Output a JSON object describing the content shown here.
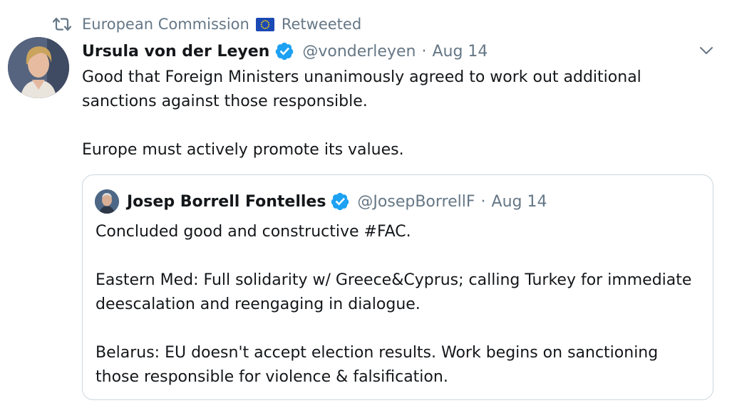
{
  "retweet": {
    "account": "European Commission",
    "status": "Retweeted"
  },
  "tweet": {
    "name": "Ursula von der Leyen",
    "handle": "@vonderleyen",
    "separator": "·",
    "date": "Aug 14",
    "paragraphs": [
      "Good that Foreign Ministers unanimously agreed to work out additional sanctions against those responsible.",
      "Europe must actively promote its values."
    ]
  },
  "quoted": {
    "name": "Josep Borrell Fontelles",
    "handle": "@JosepBorrellF",
    "separator": "·",
    "date": "Aug 14",
    "paragraphs": [
      "Concluded good and constructive #FAC.",
      "Eastern Med: Full solidarity w/ Greece&Cyprus; calling Turkey for immediate deescalation and reengaging in dialogue.",
      "Belarus: EU doesn't accept election results. Work begins on sanctioning those responsible for violence & falsification."
    ]
  },
  "icons": {
    "retweet": "retweet-icon",
    "flag": "eu-flag-icon",
    "verified": "verified-badge-icon",
    "menu": "chevron-down-icon"
  },
  "colors": {
    "text": "#14171a",
    "secondary": "#657786",
    "verified": "#1da1f2",
    "border": "#ccd6dd",
    "eu_blue": "#1b49b5",
    "eu_star": "#ffd200"
  }
}
